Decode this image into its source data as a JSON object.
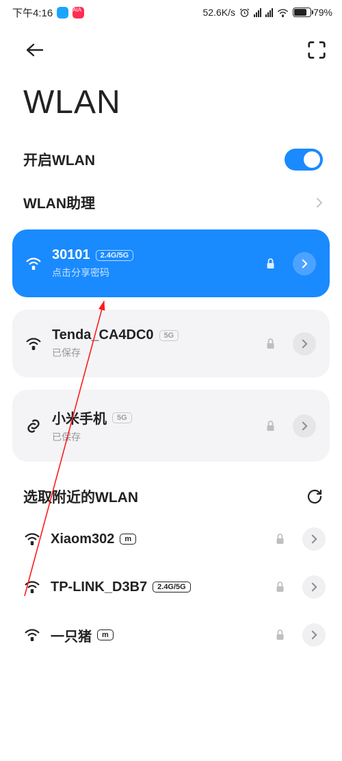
{
  "status": {
    "time": "下午4:16",
    "speed": "52.6K/s",
    "battery_pct": "79%"
  },
  "page": {
    "title": "WLAN"
  },
  "settings": {
    "wlan_toggle_label": "开启WLAN",
    "wlan_assistant_label": "WLAN助理"
  },
  "saved": [
    {
      "name": "30101",
      "band": "2.4G/5G",
      "sub": "点击分享密码",
      "connected": true,
      "link": false
    },
    {
      "name": "Tenda_CA4DC0",
      "band": "5G",
      "sub": "已保存",
      "connected": false,
      "link": false
    },
    {
      "name": "小米手机",
      "band": "5G",
      "sub": "已保存",
      "connected": false,
      "link": true
    }
  ],
  "nearby": {
    "title": "选取附近的WLAN",
    "items": [
      {
        "name": "Xiaom302",
        "badge": "m"
      },
      {
        "name": "TP-LINK_D3B7",
        "badge": "2.4G/5G"
      },
      {
        "name": "一只猪",
        "badge": "m"
      }
    ]
  }
}
